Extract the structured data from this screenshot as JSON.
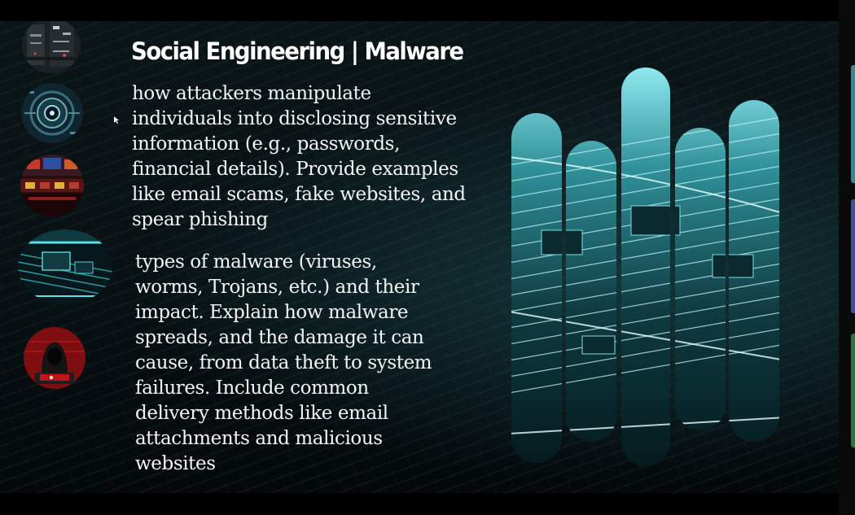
{
  "slide": {
    "title": "Social Engineering | Malware",
    "paragraph1_lines": [
      "how attackers manipulate",
      "individuals into disclosing sensitive",
      "information (e.g., passwords,",
      "financial details). Provide examples",
      "like email scams, fake websites, and",
      "spear phishing"
    ],
    "paragraph2_lines": [
      "types of malware (viruses,",
      "worms, Trojans, etc.) and their",
      "impact. Explain how malware",
      "spreads, and the damage it can",
      "cause, from data theft to system",
      "failures. Include common",
      "delivery methods like email",
      "attachments and malicious",
      "websites"
    ]
  },
  "images": {
    "thumbnails": [
      "server-room-thumbnail",
      "cyber-eye-thumbnail",
      "control-room-thumbnail",
      "circuit-board-thumbnail",
      "hooded-hacker-thumbnail"
    ],
    "hero": "circuit-board-pillars-image"
  },
  "colors": {
    "accent_teal": "#3fd0d8",
    "hacker_red": "#c0161a",
    "slide_background": "#081012"
  }
}
